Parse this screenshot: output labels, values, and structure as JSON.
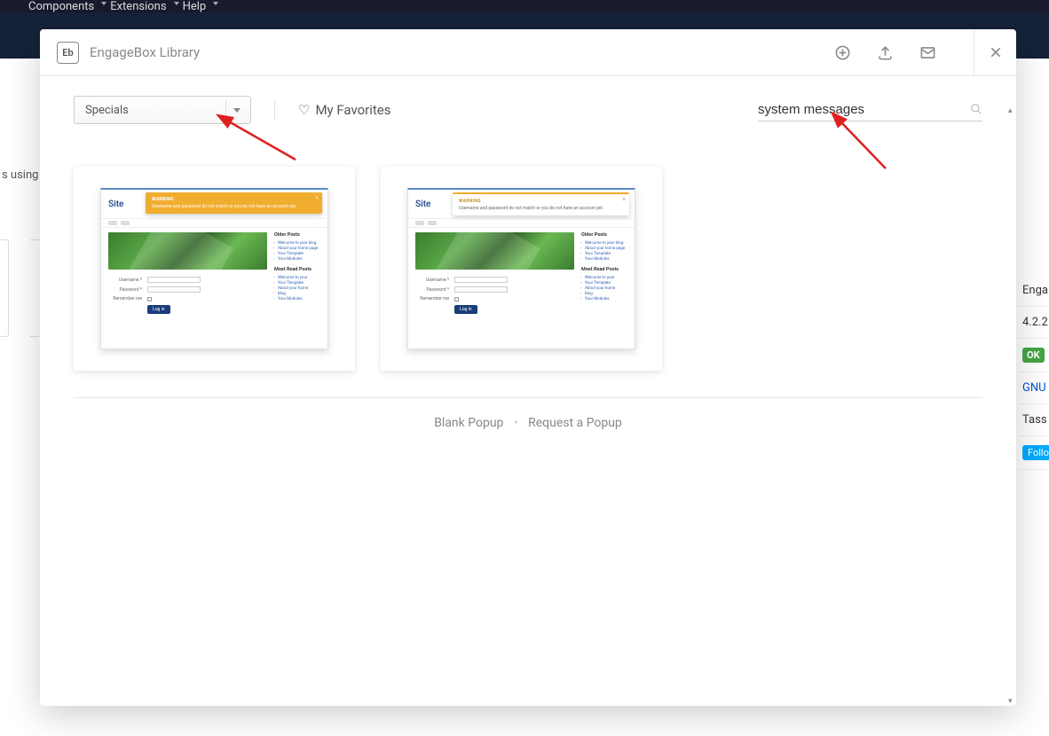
{
  "menu": {
    "components": "Components",
    "extensions": "Extensions",
    "help": "Help"
  },
  "background": {
    "text_fragment": "s using",
    "sidebar": {
      "product": "Enga",
      "version": "4.2.2",
      "status": "OK",
      "license": "GNU",
      "author": "Tass",
      "follow": "Follo"
    }
  },
  "modal": {
    "logo_text": "Eb",
    "title": "EngageBox Library",
    "filter": {
      "category": "Specials",
      "favorites": "My Favorites"
    },
    "search": {
      "value": "system messages"
    },
    "preview": {
      "site_name": "Site",
      "toast_title": "WARNING",
      "toast_msg": "Username and password do not match or you do not have an account yet.",
      "form": {
        "username": "Username *",
        "password": "Password *",
        "remember": "Remember me",
        "login": "Log in"
      },
      "older_posts": "Older Posts",
      "older_list": [
        "Welcome to your blog",
        "About your home page",
        "Your Template",
        "Your Modules"
      ],
      "most_read": "Most Read Posts",
      "most_list": [
        "Welcome to your",
        "Your Template",
        "About your home",
        "blog",
        "Your Modules"
      ]
    },
    "footer": {
      "blank": "Blank Popup",
      "request": "Request a Popup"
    }
  }
}
